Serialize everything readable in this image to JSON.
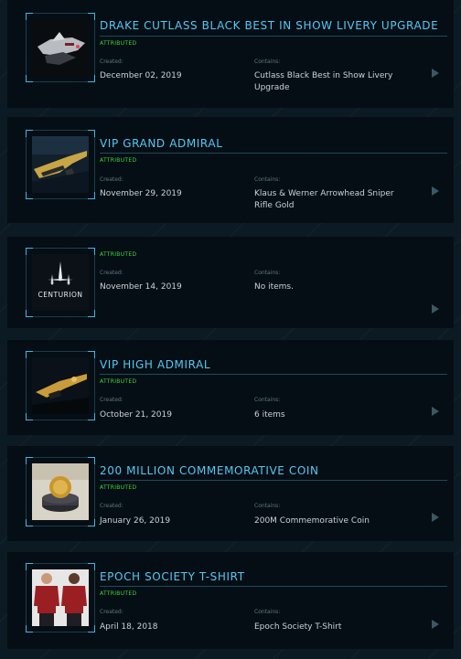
{
  "labels": {
    "created": "Created:",
    "contains": "Contains:"
  },
  "pledges": [
    {
      "title": "DRAKE CUTLASS BLACK BEST IN SHOW LIVERY UPGRADE",
      "status": "ATTRIBUTED",
      "created": "December 02, 2019",
      "contains": "Cutlass Black Best in Show Livery Upgrade",
      "thumb": "ship-thumbnail"
    },
    {
      "title": "VIP GRAND ADMIRAL",
      "status": "ATTRIBUTED",
      "created": "November 29, 2019",
      "contains": "Klaus & Werner Arrowhead Sniper Rifle Gold",
      "thumb": "rifle-thumbnail"
    },
    {
      "title": "",
      "status": "ATTRIBUTED",
      "created": "November 14, 2019",
      "contains": "No items.",
      "thumb": "centurion-logo",
      "logo_text": "CENTURION"
    },
    {
      "title": "VIP HIGH ADMIRAL",
      "status": "ATTRIBUTED",
      "created": "October 21, 2019",
      "contains": "6 items",
      "thumb": "gold-gun-thumbnail"
    },
    {
      "title": "200 MILLION COMMEMORATIVE COIN",
      "status": "ATTRIBUTED",
      "created": "January 26, 2019",
      "contains": "200M Commemorative Coin",
      "thumb": "coin-thumbnail"
    },
    {
      "title": "EPOCH SOCIETY T-SHIRT",
      "status": "ATTRIBUTED",
      "created": "April 18, 2018",
      "contains": "Epoch Society T-Shirt",
      "thumb": "tshirt-thumbnail"
    }
  ],
  "colors": {
    "accent": "#55c8f5",
    "status": "#3ed63e",
    "card_bg": "#040c12"
  }
}
